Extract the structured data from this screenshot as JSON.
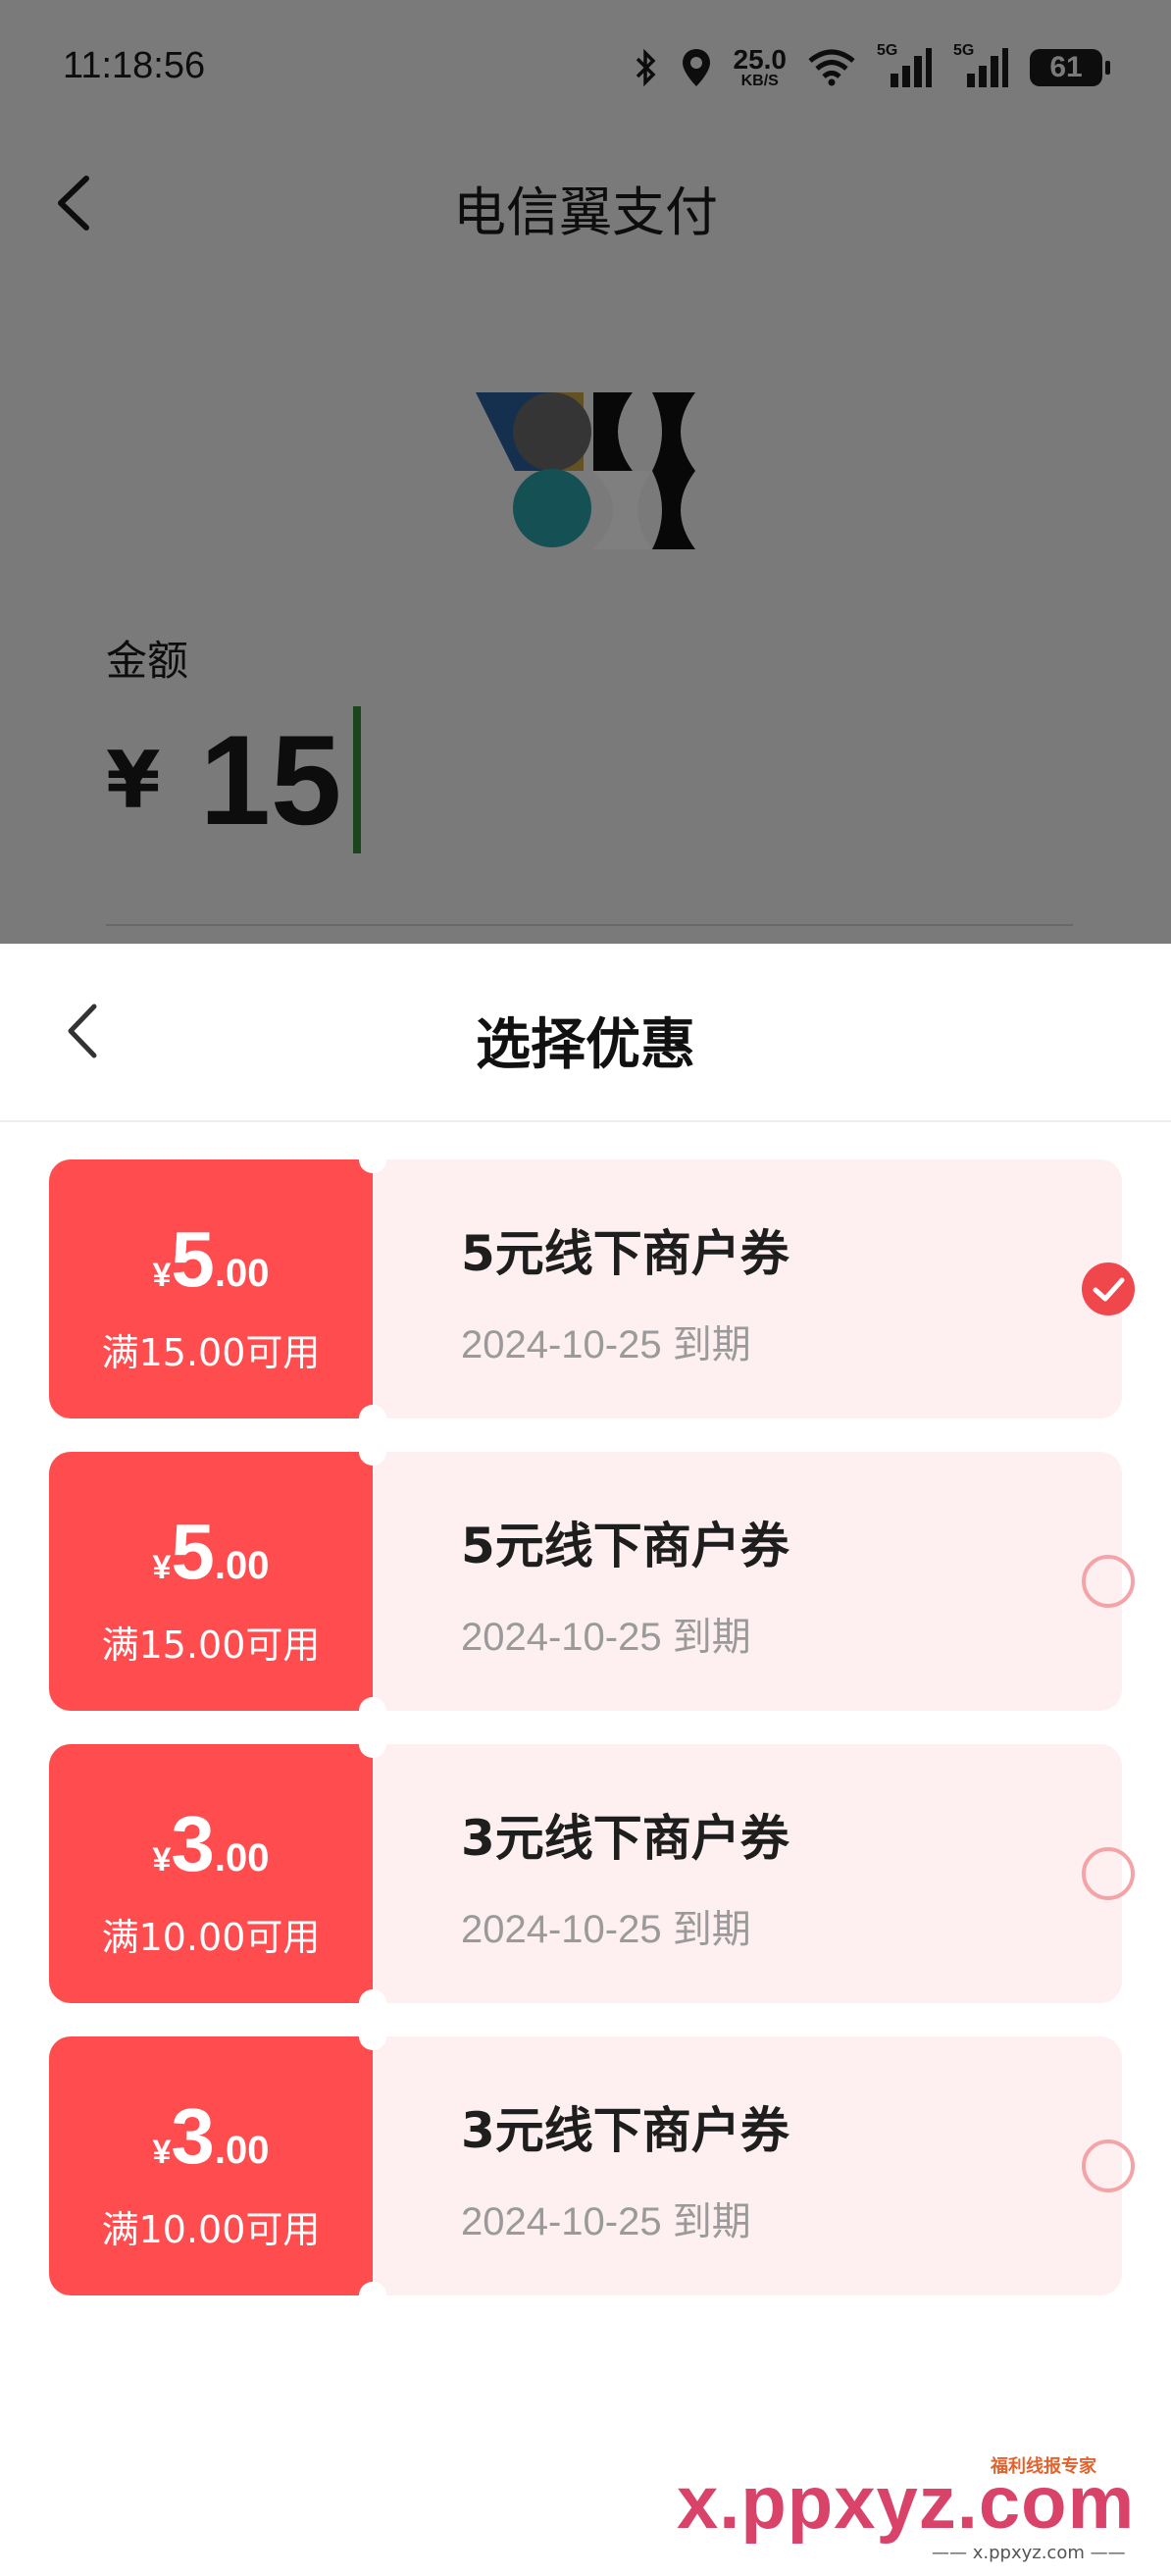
{
  "status_bar": {
    "time": "11:18:56",
    "net_speed": "25.0",
    "net_unit": "KB/S",
    "signal1": "5G",
    "signal2": "5G",
    "battery": "61"
  },
  "header": {
    "title": "电信翼支付"
  },
  "amount": {
    "label": "金额",
    "currency": "¥",
    "value": "15"
  },
  "sheet": {
    "title": "选择优惠",
    "coupons": [
      {
        "symbol": "¥",
        "integer": "5",
        "decimal": ".00",
        "condition": "满15.00可用",
        "name": "5元线下商户券",
        "expiry": "2024-10-25 到期",
        "selected": true
      },
      {
        "symbol": "¥",
        "integer": "5",
        "decimal": ".00",
        "condition": "满15.00可用",
        "name": "5元线下商户券",
        "expiry": "2024-10-25 到期",
        "selected": false
      },
      {
        "symbol": "¥",
        "integer": "3",
        "decimal": ".00",
        "condition": "满10.00可用",
        "name": "3元线下商户券",
        "expiry": "2024-10-25 到期",
        "selected": false
      },
      {
        "symbol": "¥",
        "integer": "3",
        "decimal": ".00",
        "condition": "满10.00可用",
        "name": "3元线下商户券",
        "expiry": "2024-10-25 到期",
        "selected": false
      }
    ]
  },
  "watermark": {
    "main": "x.ppxyz.com",
    "small": "福利线报专家",
    "sub": "—— x.ppxyz.com ——"
  },
  "colors": {
    "coupon_red": "#fe4c4f",
    "coupon_bg": "#fef0f1",
    "accent": "#f0474c"
  }
}
